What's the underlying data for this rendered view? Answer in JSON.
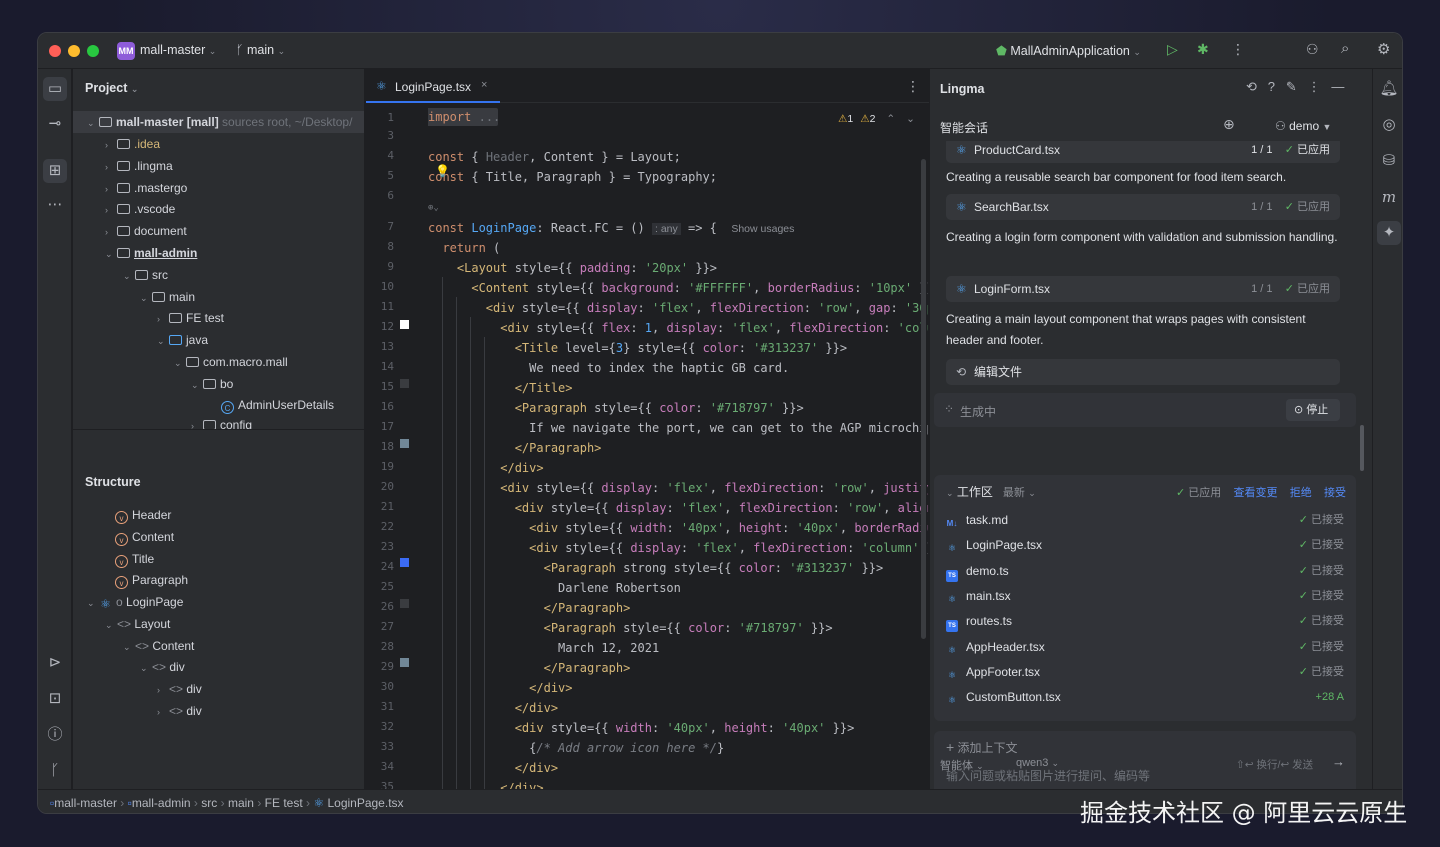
{
  "titlebar": {
    "project_badge": "MM",
    "project_name": "mall-master",
    "branch": "main",
    "run_config": "MallAdminApplication"
  },
  "project_panel": {
    "title": "Project",
    "tree": [
      {
        "label": "mall-master [mall]",
        "suffix": "sources root, ~/Desktop/"
      },
      {
        "label": ".idea"
      },
      {
        "label": ".lingma"
      },
      {
        "label": ".mastergo"
      },
      {
        "label": ".vscode"
      },
      {
        "label": "document"
      },
      {
        "label": "mall-admin"
      },
      {
        "label": "src"
      },
      {
        "label": "main"
      },
      {
        "label": "FE test"
      },
      {
        "label": "java"
      },
      {
        "label": "com.macro.mall"
      },
      {
        "label": "bo"
      },
      {
        "label": "AdminUserDetails"
      },
      {
        "label": "config"
      }
    ]
  },
  "structure_panel": {
    "title": "Structure",
    "items": [
      {
        "label": "Header"
      },
      {
        "label": "Content"
      },
      {
        "label": "Title"
      },
      {
        "label": "Paragraph"
      },
      {
        "label": "LoginPage"
      },
      {
        "label": "Layout"
      },
      {
        "label": "Content"
      },
      {
        "label": "div"
      },
      {
        "label": "div"
      },
      {
        "label": "div"
      }
    ]
  },
  "editor": {
    "tab_label": "LoginPage.tsx",
    "warnings": "1",
    "weak_warnings": "2",
    "line_numbers": [
      "1",
      "3",
      "4",
      "5",
      "6",
      "7",
      "8",
      "9",
      "10",
      "11",
      "12",
      "13",
      "14",
      "15",
      "16",
      "17",
      "18",
      "19",
      "20",
      "21",
      "22",
      "23",
      "24",
      "25",
      "26",
      "27",
      "28",
      "29",
      "30",
      "31",
      "32",
      "33",
      "34",
      "35"
    ],
    "hint_any": ": any",
    "hint_usages": "Show usages"
  },
  "lingma": {
    "title": "Lingma",
    "session_label": "智能会话",
    "user": "demo",
    "cards": [
      {
        "file": "ProductCard.tsx",
        "count": "1 / 1",
        "status": "已应用"
      },
      {
        "file": "SearchBar.tsx",
        "count": "1 / 1",
        "status": "已应用"
      },
      {
        "file": "LoginForm.tsx",
        "count": "1 / 1",
        "status": "已应用"
      }
    ],
    "paras": [
      "Creating a reusable search bar component for food item search.",
      "Creating a login form component with validation and submission handling.",
      "Creating a main layout component that wraps pages with consistent header and footer."
    ],
    "edit_files": "编辑文件",
    "generating": "生成中",
    "stop": "停止",
    "workspace": {
      "title": "工作区",
      "latest": "最新",
      "applied": "已应用",
      "view_changes": "查看变更",
      "reject": "拒绝",
      "accept": "接受",
      "files": [
        {
          "name": "task.md",
          "status": "已接受"
        },
        {
          "name": "LoginPage.tsx",
          "status": "已接受"
        },
        {
          "name": "demo.ts",
          "status": "已接受"
        },
        {
          "name": "main.tsx",
          "status": "已接受"
        },
        {
          "name": "routes.ts",
          "status": "已接受"
        },
        {
          "name": "AppHeader.tsx",
          "status": "已接受"
        },
        {
          "name": "AppFooter.tsx",
          "status": "已接受"
        },
        {
          "name": "CustomButton.tsx",
          "status": "+28 A"
        }
      ]
    },
    "add_context": "添加上下文",
    "input_placeholder": "输入问题或粘贴图片进行提问、编码等",
    "mode": "智能体",
    "model": "qwen3",
    "send_hint": "⇧↩ 换行/↩ 发送"
  },
  "statusbar": {
    "crumbs": [
      "mall-master",
      "mall-admin",
      "src",
      "main",
      "FE test",
      "LoginPage.tsx"
    ]
  },
  "watermark": "掘金技术社区 @ 阿里云云原生",
  "colors": {
    "accent": "#3574f0",
    "bg": "#1e1f22",
    "panel": "#2b2d30",
    "ok": "#5fb865"
  }
}
